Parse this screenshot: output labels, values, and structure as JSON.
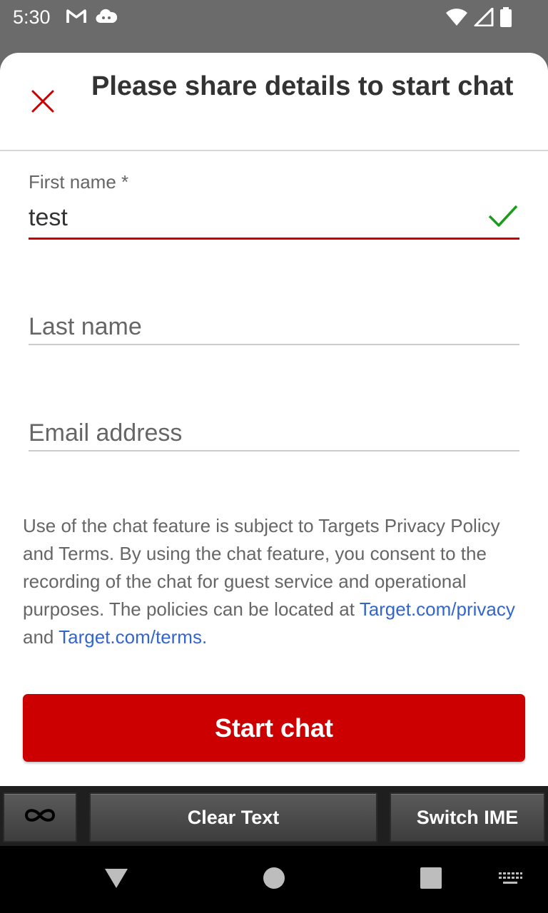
{
  "status_bar": {
    "time": "5:30",
    "left_icons": [
      "gmail-icon",
      "cloud-icon"
    ],
    "right_icons": [
      "wifi-icon",
      "signal-icon",
      "battery-icon"
    ]
  },
  "dialog": {
    "title": "Please share details to start chat",
    "close_icon": "close-icon",
    "accent_color": "#cc0000"
  },
  "form": {
    "first_name": {
      "label": "First name *",
      "value": "test",
      "valid_icon": "checkmark-icon",
      "valid_color": "#1a9e1a"
    },
    "last_name": {
      "placeholder": "Last name",
      "value": ""
    },
    "email": {
      "placeholder": "Email address",
      "value": ""
    }
  },
  "disclaimer": {
    "text_before": "Use of the chat feature is subject to Targets Privacy Policy and Terms. By using the chat feature, you consent to the recording of the chat for guest service and operational purposes. The policies can be located at ",
    "privacy_link": "Target.com/privacy",
    "text_middle": " and ",
    "terms_link": "Target.com/terms."
  },
  "start_button": {
    "label": "Start chat"
  },
  "ime_toolbar": {
    "infinity_icon": "infinity-icon",
    "clear_text_label": "Clear Text",
    "switch_ime_label": "Switch IME"
  },
  "nav_bar": {
    "items": [
      "back-icon",
      "home-icon",
      "recents-icon",
      "keyboard-icon"
    ]
  }
}
